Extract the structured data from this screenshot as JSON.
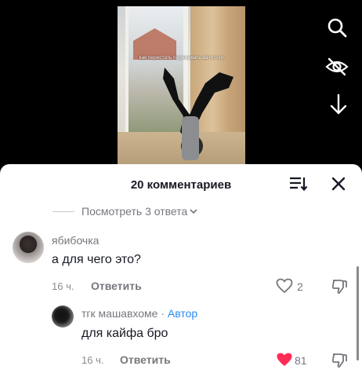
{
  "video": {
    "caption": "как перестать переживать за что-то"
  },
  "side_icons": [
    "search-icon",
    "eye-off-icon",
    "download-arrow-icon"
  ],
  "comments_sheet": {
    "title": "20 комментариев",
    "view_replies": "Посмотреть 3 ответа",
    "comment": {
      "username": "ябибочка",
      "text": "а для чего это?",
      "time": "16 ч.",
      "reply_label": "Ответить",
      "likes": "2"
    },
    "reply": {
      "username": "тгк машавхоме",
      "separator": " · ",
      "author_badge": "Автор",
      "text": "для кайфа бро",
      "time": "16 ч.",
      "reply_label": "Ответить",
      "likes": "81",
      "liked_color": "#fe2c55"
    }
  }
}
